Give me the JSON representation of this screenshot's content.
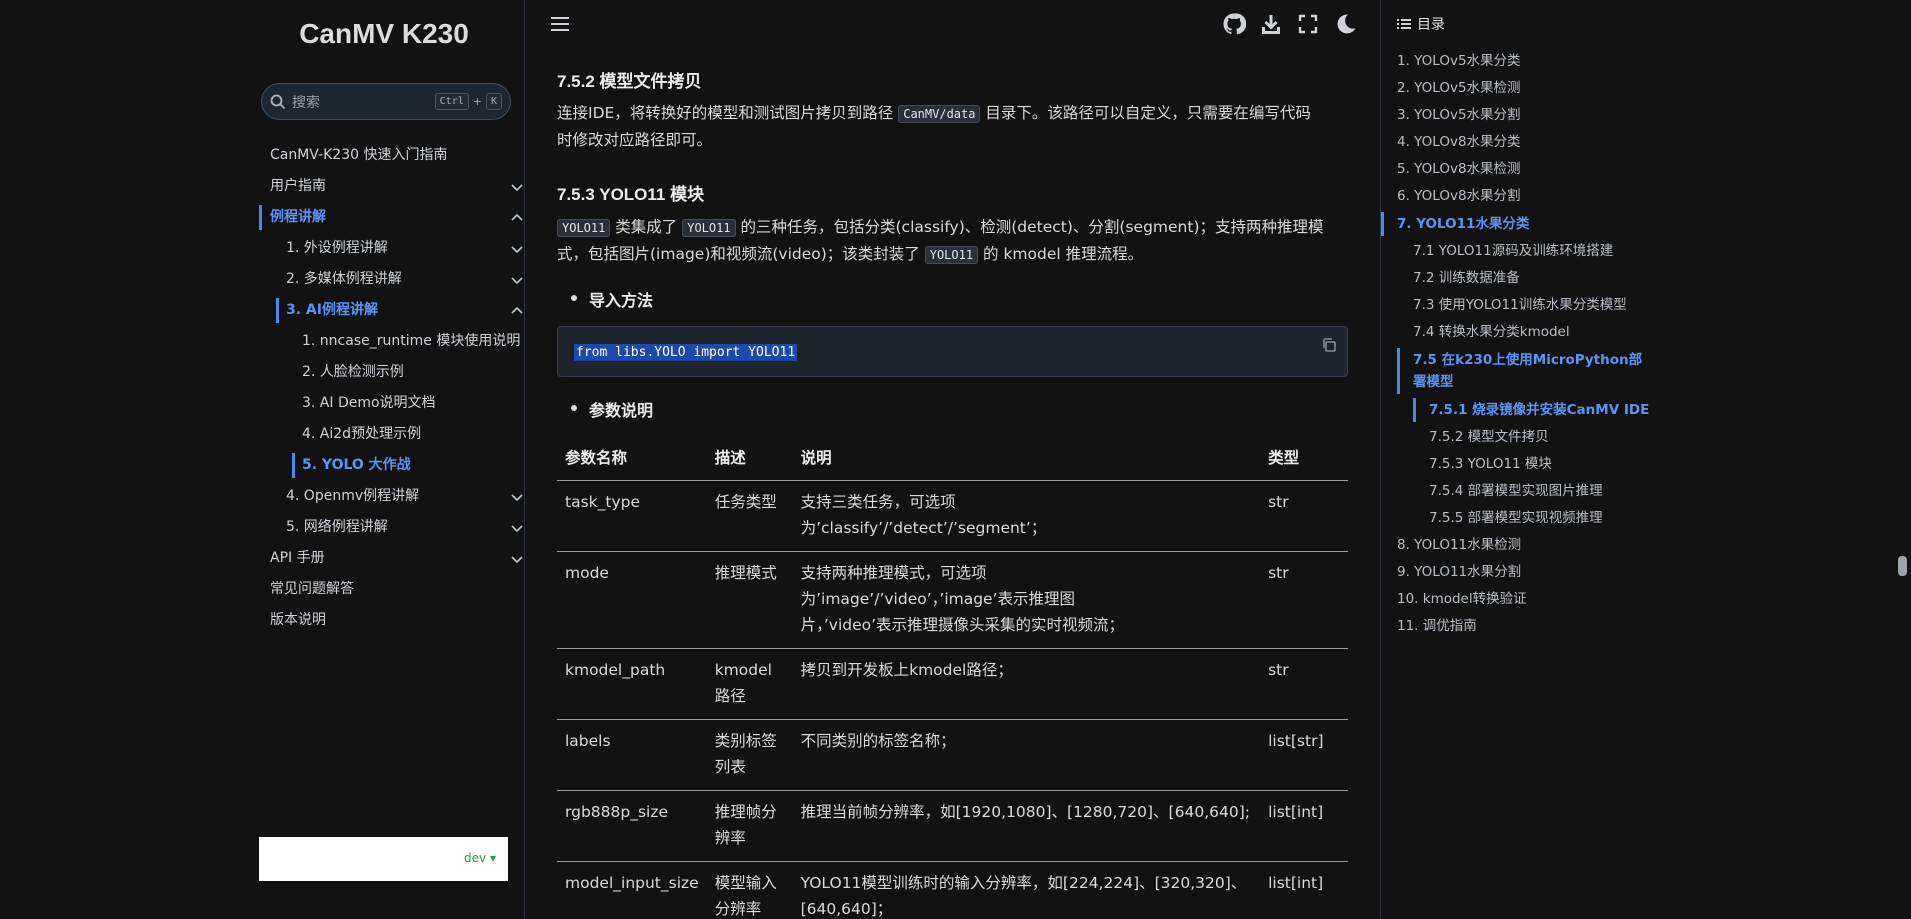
{
  "site": {
    "title": "CanMV K230"
  },
  "search": {
    "placeholder": "搜索",
    "key1": "Ctrl",
    "plus": "+",
    "key2": "K"
  },
  "nav": {
    "items": [
      {
        "label": "CanMV-K230 快速入门指南"
      },
      {
        "label": "用户指南"
      },
      {
        "label": "例程讲解"
      },
      {
        "label": "1. 外设例程讲解"
      },
      {
        "label": "2. 多媒体例程讲解"
      },
      {
        "label": "3. AI例程讲解"
      },
      {
        "label": "1. nncase_runtime 模块使用说明"
      },
      {
        "label": "2. 人脸检测示例"
      },
      {
        "label": "3. AI Demo说明文档"
      },
      {
        "label": "4. Ai2d预处理示例"
      },
      {
        "label": "5. YOLO 大作战"
      },
      {
        "label": "4. Openmv例程讲解"
      },
      {
        "label": "5. 网络例程讲解"
      },
      {
        "label": "API 手册"
      },
      {
        "label": "常见问题解答"
      },
      {
        "label": "版本说明"
      }
    ]
  },
  "version": {
    "label": "dev"
  },
  "toolbar": {
    "icons": [
      "menu-icon",
      "github-icon",
      "download-icon",
      "fullscreen-icon",
      "dark-mode-icon"
    ]
  },
  "content": {
    "h_752": "7.5.2 模型文件拷贝",
    "p1_a": "连接IDE，将转换好的模型和测试图片拷贝到路径 ",
    "p1_code": "CanMV/data",
    "p1_b": " 目录下。该路径可以自定义，只需要在编写代码",
    "p1_c": "时修改对应路径即可。",
    "h_753": "7.5.3 YOLO11 模块",
    "p2_code1": "YOLO11",
    "p2_a": " 类集成了 ",
    "p2_code2": "YOLO11",
    "p2_b": " 的三种任务，包括分类(classify)、检测(detect)、分割(segment)；支持两种推理模",
    "p2_c": "式，包括图片(image)和视频流(video)；该类封装了 ",
    "p2_code3": "YOLO11",
    "p2_d": " 的 kmodel 推理流程。",
    "bullet1": "导入方法",
    "code": "from libs.YOLO import YOLO11",
    "bullet2": "参数说明"
  },
  "table": {
    "headers": [
      "参数名称",
      "描述",
      "说明",
      "类型"
    ],
    "rows": [
      [
        "task_type",
        "任务类型",
        "支持三类任务，可选项\n为’classify’/’detect’/’segment’；",
        "str"
      ],
      [
        "mode",
        "推理模式",
        "支持两种推理模式，可选项\n为’image’/’video’，’image’表示推理图\n片，’video’表示推理摄像头采集的实时视频流；",
        "str"
      ],
      [
        "kmodel_path",
        "kmodel\n路径",
        "拷贝到开发板上kmodel路径；",
        "str"
      ],
      [
        "labels",
        "类别标签\n列表",
        "不同类别的标签名称；",
        "list[str]"
      ],
      [
        "rgb888p_size",
        "推理帧分\n辨率",
        "推理当前帧分辨率，如[1920,1080]、[1280,720]、[640,640];",
        "list[int]"
      ],
      [
        "model_input_size",
        "模型输入\n分辨率",
        "YOLO11模型训练时的输入分辨率，如[224,224]、[320,320]、\n[640,640]；",
        "list[int]"
      ]
    ]
  },
  "toc": {
    "title": "目录",
    "items": [
      {
        "label": "1. YOLOv5水果分类"
      },
      {
        "label": "2. YOLOv5水果检测"
      },
      {
        "label": "3. YOLOv5水果分割"
      },
      {
        "label": "4. YOLOv8水果分类"
      },
      {
        "label": "5. YOLOv8水果检测"
      },
      {
        "label": "6. YOLOv8水果分割"
      },
      {
        "label": "7. YOLO11水果分类"
      },
      {
        "label": "7.1 YOLO11源码及训练环境搭建"
      },
      {
        "label": "7.2 训练数据准备"
      },
      {
        "label": "7.3 使用YOLO11训练水果分类模型"
      },
      {
        "label": "7.4 转换水果分类kmodel"
      },
      {
        "label": "7.5 在k230上使用MicroPython部"
      },
      {
        "label": "署模型"
      },
      {
        "label": "7.5.1 烧录镜像并安装CanMV IDE"
      },
      {
        "label": "7.5.2 模型文件拷贝"
      },
      {
        "label": "7.5.3 YOLO11 模块"
      },
      {
        "label": "7.5.4 部署模型实现图片推理"
      },
      {
        "label": "7.5.5 部署模型实现视频推理"
      },
      {
        "label": "8. YOLO11水果检测"
      },
      {
        "label": "9. YOLO11水果分割"
      },
      {
        "label": "10. kmodel转换验证"
      },
      {
        "label": "11. 调优指南"
      }
    ]
  },
  "colors": {
    "accent": "#5a95f5",
    "background": "#121212",
    "code_highlight": "#1d4aa8"
  }
}
